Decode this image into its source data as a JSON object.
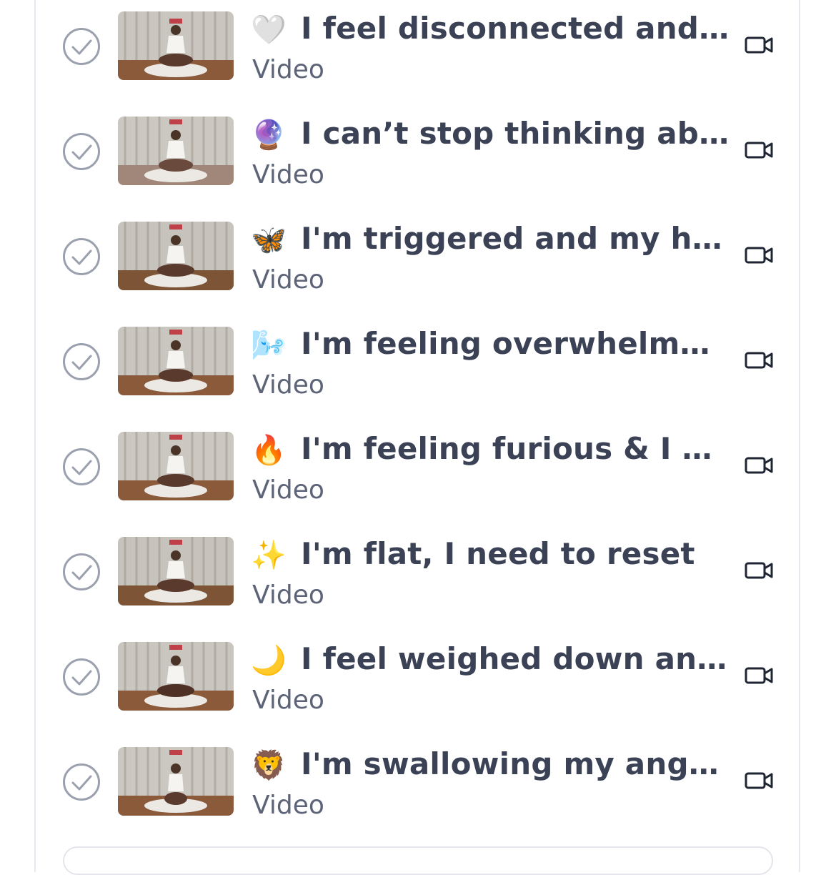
{
  "lessons": [
    {
      "emoji": "🤍",
      "emoji_name": "white-heart-emoji",
      "title": "I feel disconnected and I ...",
      "type": "Video"
    },
    {
      "emoji": "🔮",
      "emoji_name": "crystal-ball-emoji",
      "title": "I can’t stop thinking abo...",
      "type": "Video"
    },
    {
      "emoji": "🦋",
      "emoji_name": "butterfly-emoji",
      "title": "I'm triggered and my hea...",
      "type": "Video"
    },
    {
      "emoji": "🌬️",
      "emoji_name": "wind-face-emoji",
      "title": "I'm feeling overwhelmed ...",
      "type": "Video"
    },
    {
      "emoji": "🔥",
      "emoji_name": "fire-emoji",
      "title": "I'm feeling furious & I ne...",
      "type": "Video"
    },
    {
      "emoji": "✨",
      "emoji_name": "sparkles-emoji",
      "title": "I'm flat, I need to reset",
      "type": "Video"
    },
    {
      "emoji": "🌙",
      "emoji_name": "crescent-moon-emoji",
      "title": "I feel weighed down and ...",
      "type": "Video"
    },
    {
      "emoji": "🦁",
      "emoji_name": "lion-emoji",
      "title": "I'm swallowing my anger ...",
      "type": "Video"
    }
  ],
  "colors": {
    "title": "#3b4256",
    "subtitle": "#5d6478",
    "check": "#9aa0ae",
    "border": "#e6e8ee"
  }
}
